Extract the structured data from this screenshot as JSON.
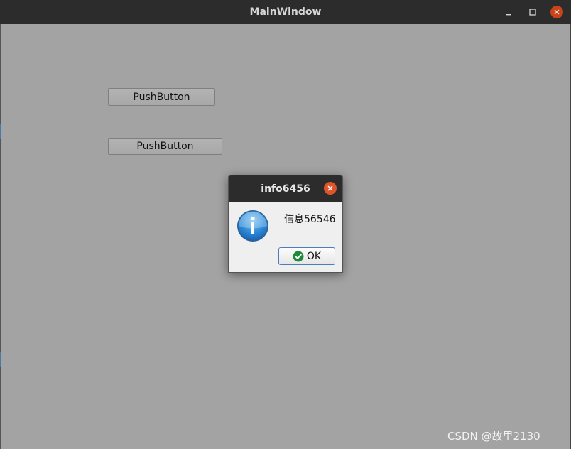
{
  "window": {
    "title": "MainWindow"
  },
  "main": {
    "button1_label": "PushButton",
    "button2_label": "PushButton"
  },
  "dialog": {
    "title": "info6456",
    "message": "信息56546",
    "ok_label": "OK",
    "icon": "information-icon"
  },
  "watermark": "CSDN @故里2130",
  "colors": {
    "titlebar": "#2c2c2c",
    "client_bg": "#a3a3a3",
    "close_accent": "#e0542a",
    "ok_border": "#4a7cc0",
    "check_green": "#1f8a3a"
  }
}
